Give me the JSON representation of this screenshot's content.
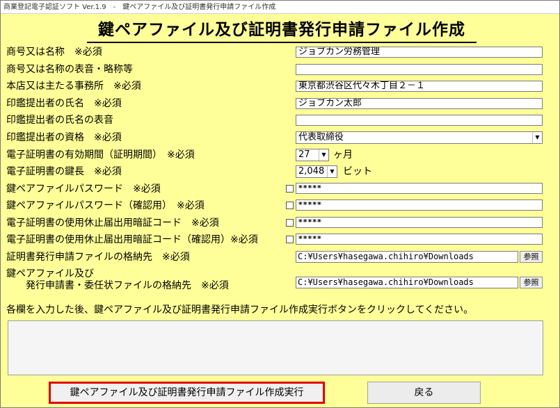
{
  "window": {
    "title": "商業登記電子認証ソフト Ver.1.9　-　鍵ペアファイル及び証明書発行申請ファイル作成"
  },
  "form": {
    "heading": "鍵ペアファイル及び証明書発行申請ファイル作成",
    "trade_name": {
      "label": "商号又は名称　※必須",
      "value": "ジョブカン労務管理"
    },
    "trade_name_notation": {
      "label": "商号又は名称の表音・略称等",
      "value": ""
    },
    "head_office": {
      "label": "本店又は主たる事務所　※必須",
      "value": "東京都渋谷区代々木丁目２－１"
    },
    "seal_submitter_name": {
      "label": "印鑑提出者の氏名　※必須",
      "value": "ジョブカン太郎"
    },
    "seal_submitter_reading": {
      "label": "印鑑提出者の氏名の表音",
      "value": ""
    },
    "seal_submitter_qualification": {
      "label": "印鑑提出者の資格　※必須",
      "value": "代表取締役",
      "arrow": "▼"
    },
    "validity_period": {
      "label": "電子証明書の有効期間（証明期間）　※必須",
      "value": "27",
      "unit": "ヶ月",
      "arrow": "▼"
    },
    "key_length": {
      "label": "電子証明書の鍵長　※必須",
      "value": "2,048",
      "unit": "ビット",
      "arrow": "▼"
    },
    "key_password": {
      "label": "鍵ペアファイルパスワード　※必須",
      "value": "*****"
    },
    "key_password_confirm": {
      "label": "鍵ペアファイルパスワード（確認用）　※必須",
      "value": "*****"
    },
    "suspension_code": {
      "label": "電子証明書の使用休止届出用暗証コード　※必須",
      "value": "*****"
    },
    "suspension_code_confirm": {
      "label": "電子証明書の使用休止届出用暗証コード（確認用）※必須",
      "value": "*****"
    },
    "application_file_location": {
      "label": "証明書発行申請ファイルの格納先　※必須",
      "value": "C:¥Users¥hasegawa.chihiro¥Downloads",
      "browse": "参照"
    },
    "keypair_location": {
      "label_line1": "鍵ペアファイル及び",
      "label_line2": "発行申請書・委任状ファイルの格納先　※必須",
      "value": "C:¥Users¥hasegawa.chihiro¥Downloads",
      "browse": "参照"
    }
  },
  "instruction": "各欄を入力した後、鍵ペアファイル及び証明書発行申請ファイル作成実行ボタンをクリックしてください。",
  "message_area": "",
  "buttons": {
    "create": "鍵ペアファイル及び証明書発行申請ファイル作成実行",
    "back": "戻る"
  }
}
